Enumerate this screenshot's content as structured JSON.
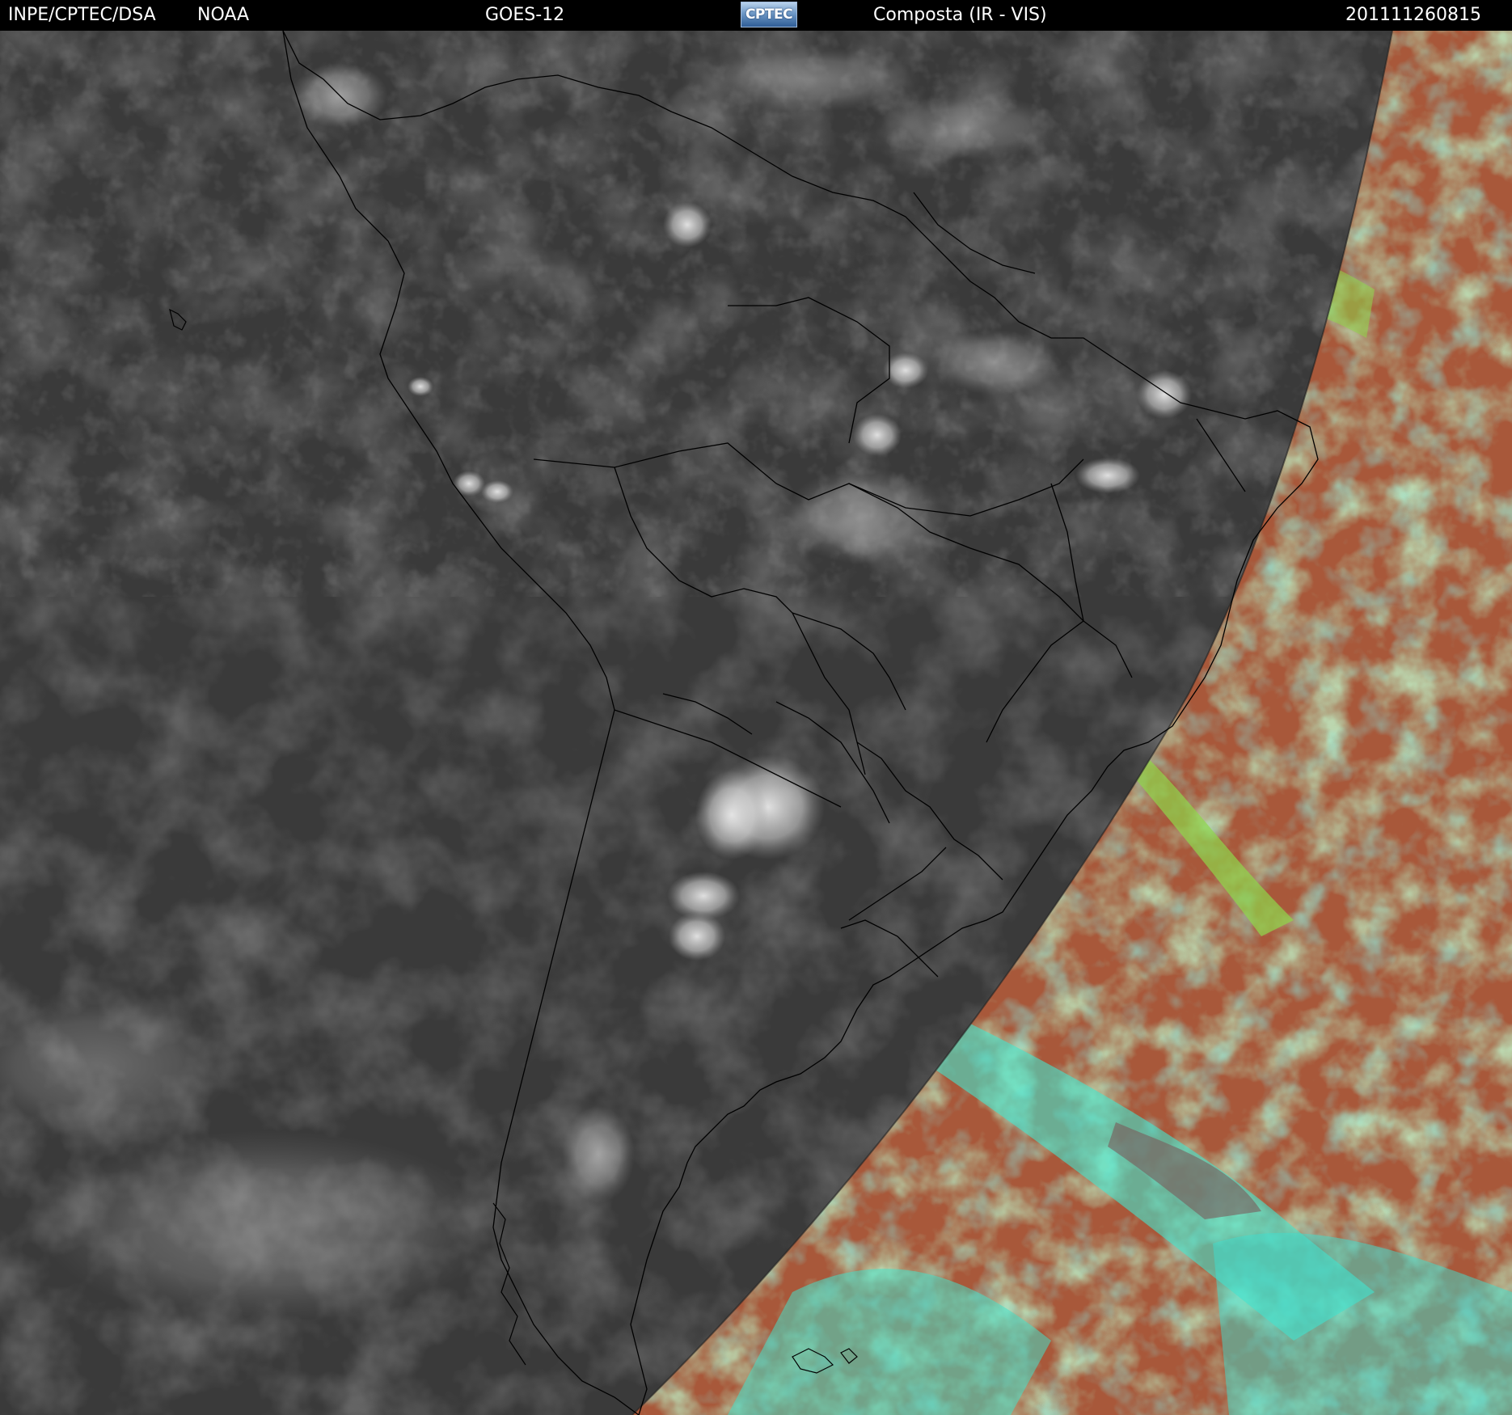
{
  "header": {
    "source": "INPE/CPTEC/DSA",
    "agency": "NOAA",
    "satellite": "GOES-12",
    "logo_text": "CPTEC",
    "product": "Composta (IR - VIS)",
    "timestamp": "201111260815"
  },
  "imagery": {
    "night_side_color": "#3a3a3a",
    "day_side_colors": [
      "#a8583a",
      "#8fd74a",
      "#3fe6c8",
      "#7a5a5a"
    ],
    "coastline_color": "#000000"
  }
}
